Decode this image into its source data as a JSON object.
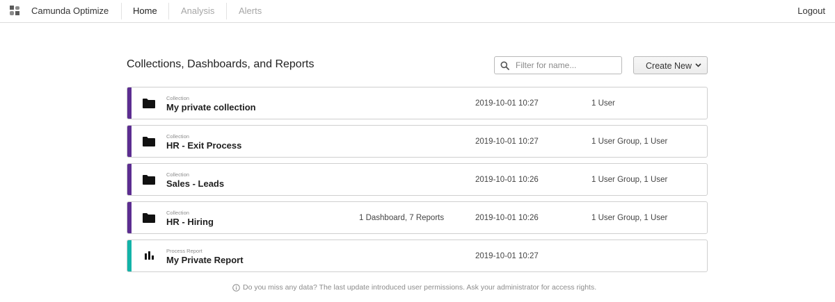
{
  "header": {
    "app_title": "Camunda Optimize",
    "nav": [
      {
        "label": "Home",
        "active": true
      },
      {
        "label": "Analysis",
        "active": false
      },
      {
        "label": "Alerts",
        "active": false
      }
    ],
    "logout_label": "Logout",
    "logo_icon": "camunda-logo-icon"
  },
  "main": {
    "title": "Collections, Dashboards, and Reports",
    "search": {
      "placeholder": "Filter for name...",
      "value": "",
      "icon": "search-icon"
    },
    "create_new_label": "Create New",
    "items": [
      {
        "type_label": "Collection",
        "name": "My private collection",
        "contents": "",
        "modified": "2019-10-01 10:27",
        "users": "1 User",
        "icon": "folder-icon",
        "accent": "#5c2d91"
      },
      {
        "type_label": "Collection",
        "name": "HR - Exit Process",
        "contents": "",
        "modified": "2019-10-01 10:27",
        "users": "1 User Group, 1 User",
        "icon": "folder-icon",
        "accent": "#5c2d91"
      },
      {
        "type_label": "Collection",
        "name": "Sales - Leads",
        "contents": "",
        "modified": "2019-10-01 10:26",
        "users": "1 User Group, 1 User",
        "icon": "folder-icon",
        "accent": "#5c2d91"
      },
      {
        "type_label": "Collection",
        "name": "HR - Hiring",
        "contents": "1 Dashboard, 7 Reports",
        "modified": "2019-10-01 10:26",
        "users": "1 User Group, 1 User",
        "icon": "folder-icon",
        "accent": "#5c2d91"
      },
      {
        "type_label": "Process Report",
        "name": "My Private Report",
        "contents": "",
        "modified": "2019-10-01 10:27",
        "users": "",
        "icon": "bar-chart-icon",
        "accent": "#12b3a8"
      }
    ],
    "footer_note": "Do you miss any data? The last update introduced user permissions. Ask your administrator for access rights."
  },
  "colors": {
    "collection_accent": "#5c2d91",
    "report_accent": "#12b3a8",
    "border": "#cfcfcf"
  }
}
